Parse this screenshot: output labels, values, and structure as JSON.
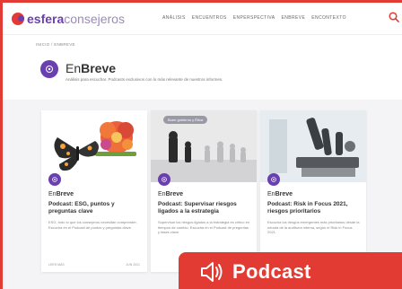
{
  "header": {
    "logo_part1": "esfera",
    "logo_part2": "consejeros",
    "nav": [
      "ANÁLISIS",
      "ENCUENTROS",
      "ENPERSPECTIVA",
      "ENBREVE",
      "ENCONTEXTO"
    ]
  },
  "breadcrumb": "INICIO / ENBREVE",
  "hero": {
    "title_prefix": "En",
    "title_bold": "Breve",
    "subtitle": "Análisis para escuchar. Podcasts exclusivos con lo más relevante de nuestros informes."
  },
  "cards": [
    {
      "brand_prefix": "En",
      "brand_bold": "Breve",
      "title": "Podcast: ESG, puntos y preguntas clave",
      "desc": "ESG, todo lo que los consejeros necesitan comprender. Escucha en el Podcast de puntos y preguntas clave.",
      "foot_left": "LEER MÁS",
      "foot_right": "JUN 2021"
    },
    {
      "tag": "Buen gobierno y Ética",
      "brand_prefix": "En",
      "brand_bold": "Breve",
      "title": "Podcast: Supervisar riesgos ligados a la estrategia",
      "desc": "Supervisar los riesgos ligados a la estrategia es crítico en tiempos de cambio. Escucha en el Podcast de preguntas y fases clave.",
      "foot_left": "",
      "foot_right": ""
    },
    {
      "brand_prefix": "En",
      "brand_bold": "Breve",
      "title": "Podcast: Risk in Focus 2021, riesgos prioritarios",
      "desc": "Escucha los riesgos emergentes más prioritarios desde la mirada de la auditoría interna, según el Risk in Focus 2021.",
      "foot_left": "",
      "foot_right": ""
    }
  ],
  "banner": {
    "label": "Podcast"
  },
  "colors": {
    "accent_red": "#e23b34",
    "brand_purple": "#6a3fb0"
  },
  "icons": {
    "search": "search-icon",
    "speaker": "speaker-icon",
    "podcast_badge": "podcast-badge-icon"
  }
}
